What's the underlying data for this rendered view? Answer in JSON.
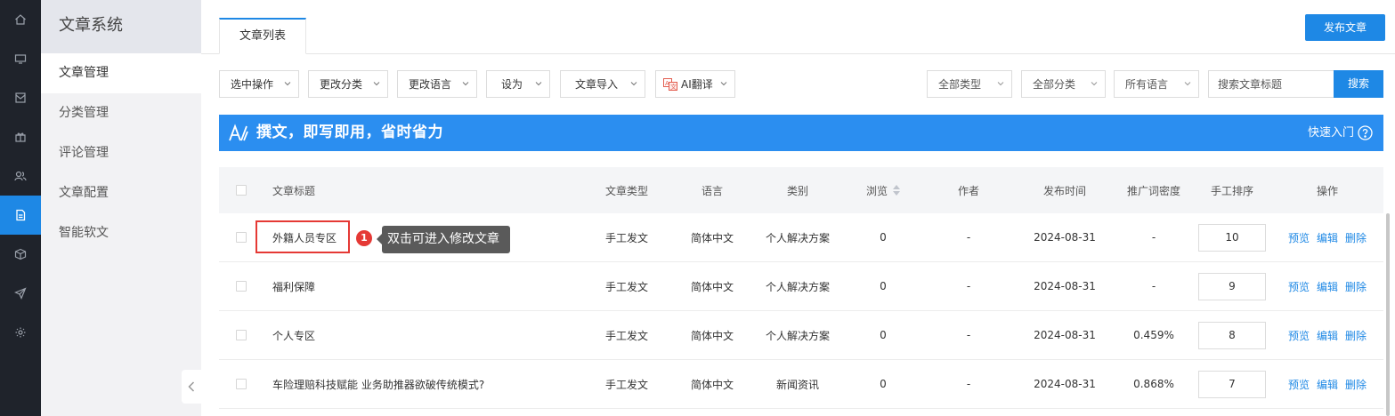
{
  "rail": [
    "home-icon",
    "monitor-icon",
    "mail-icon",
    "gift-icon",
    "users-icon",
    "document-icon",
    "box-icon",
    "send-icon",
    "settings-icon"
  ],
  "rail_active_index": 5,
  "sidebar": {
    "title": "文章系统",
    "items": [
      {
        "label": "文章管理"
      },
      {
        "label": "分类管理"
      },
      {
        "label": "评论管理"
      },
      {
        "label": "文章配置"
      },
      {
        "label": "智能软文"
      }
    ],
    "active_index": 0
  },
  "header": {
    "tab_label": "文章列表",
    "publish_label": "发布文章"
  },
  "toolbar": {
    "select_action": "选中操作",
    "change_category": "更改分类",
    "change_language": "更改语言",
    "set_as": "设为",
    "import": "文章导入",
    "ai_translate": "AI翻译",
    "filter_type": "全部类型",
    "filter_category": "全部分类",
    "filter_language": "所有语言",
    "search_placeholder": "搜索文章标题",
    "search_label": "搜索"
  },
  "banner": {
    "text": "撰文，即写即用，省时省力",
    "link": "快速入门"
  },
  "table": {
    "headers": [
      "文章标题",
      "文章类型",
      "语言",
      "类别",
      "浏览",
      "作者",
      "发布时间",
      "推广词密度",
      "手工排序",
      "操作"
    ],
    "rows": [
      {
        "title": "外籍人员专区",
        "type": "手工发文",
        "language": "简体中文",
        "category": "个人解决方案",
        "views": "0",
        "author": "-",
        "date": "2024-08-31",
        "density": "-",
        "order": "10"
      },
      {
        "title": "福利保障",
        "type": "手工发文",
        "language": "简体中文",
        "category": "个人解决方案",
        "views": "0",
        "author": "-",
        "date": "2024-08-31",
        "density": "-",
        "order": "9"
      },
      {
        "title": "个人专区",
        "type": "手工发文",
        "language": "简体中文",
        "category": "个人解决方案",
        "views": "0",
        "author": "-",
        "date": "2024-08-31",
        "density": "0.459%",
        "order": "8"
      },
      {
        "title": "车险理赔科技赋能 业务助推器欲破传统模式?",
        "type": "手工发文",
        "language": "简体中文",
        "category": "新闻资讯",
        "views": "0",
        "author": "-",
        "date": "2024-08-31",
        "density": "0.868%",
        "order": "7"
      }
    ],
    "actions": {
      "preview": "预览",
      "edit": "编辑",
      "delete": "删除"
    }
  },
  "annotation": {
    "step": "1",
    "tooltip": "双击可进入修改文章"
  },
  "colors": {
    "accent": "#1e88e5",
    "banner": "#2b8ef0",
    "rail": "#1f232b",
    "highlight": "#e53935"
  }
}
